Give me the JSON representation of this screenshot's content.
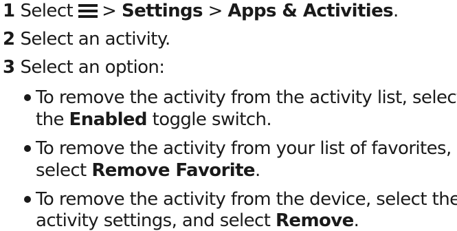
{
  "steps": [
    {
      "number": "1",
      "prefix": "Select",
      "icon": "menu-icon",
      "path": "> ",
      "settings": "Settings",
      "sep": " > ",
      "apps": "Apps & Activities",
      "period": "."
    },
    {
      "number": "2",
      "text": "Select an activity."
    },
    {
      "number": "3",
      "text": "Select an option:"
    }
  ],
  "options": [
    {
      "line1": "To remove the activity from the activity list, select",
      "line2_pre": "the ",
      "line2_bold": "Enabled",
      "line2_post": " toggle switch."
    },
    {
      "line1": "To remove the activity from your list of favorites,",
      "line2_pre": "select ",
      "line2_bold": "Remove Favorite",
      "line2_post": "."
    },
    {
      "line1": "To remove the activity from the device, select the",
      "line2_pre": "activity settings, and select ",
      "line2_bold": "Remove",
      "line2_post": "."
    }
  ]
}
